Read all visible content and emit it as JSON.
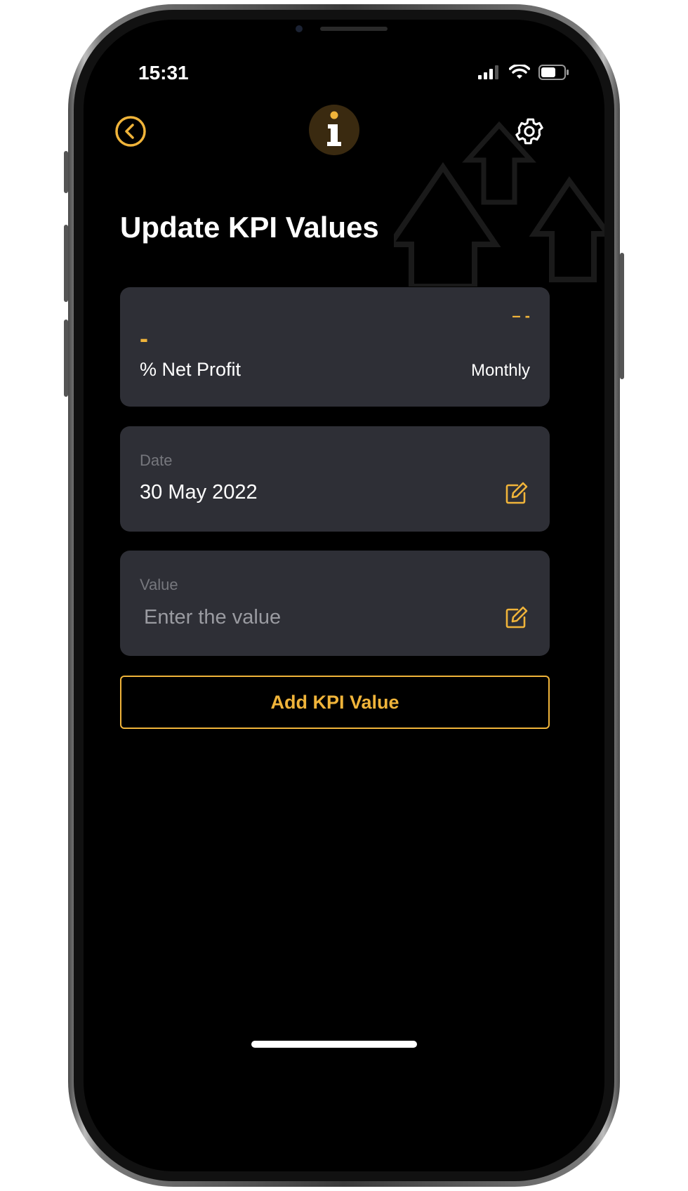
{
  "status_bar": {
    "time": "15:31"
  },
  "header": {
    "back_icon": "chevron-left-circle-icon",
    "info_icon": "info-icon",
    "settings_icon": "gear-icon"
  },
  "page": {
    "title": "Update KPI Values"
  },
  "kpi_card": {
    "value_left": "-",
    "value_right": "– -",
    "name": "% Net Profit",
    "frequency": "Monthly"
  },
  "date_field": {
    "label": "Date",
    "value": "30 May 2022"
  },
  "value_field": {
    "label": "Value",
    "value": "",
    "placeholder": "Enter the value"
  },
  "actions": {
    "add_label": "Add KPI Value"
  },
  "colors": {
    "accent": "#f0b43a",
    "card": "#2e2f36",
    "background": "#000000"
  }
}
